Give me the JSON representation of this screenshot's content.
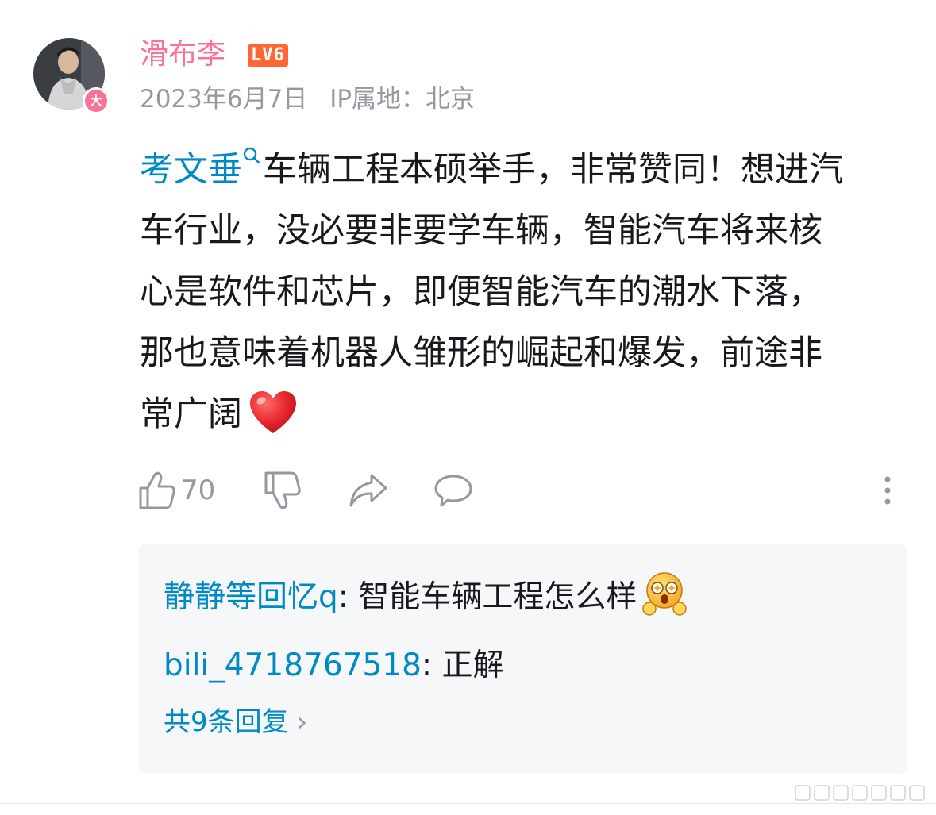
{
  "comment": {
    "username": "滑布李",
    "level": "LV6",
    "avatar_badge": "大",
    "date": "2023年6月7日",
    "ip_location": "IP属地：北京",
    "jump_keyword": "考文垂",
    "text_line_1": "车辆工程本硕举手，非常赞同！想进汽",
    "text_line_2": "车行业，没必要非要学车辆，智能汽车将来核",
    "text_line_3": "心是软件和芯片，即便智能汽车的潮水下落，",
    "text_line_4": "那也意味着机器人雏形的崛起和爆发，前途非",
    "text_line_5": "常广阔",
    "emoji": "heart-emoji"
  },
  "actions": {
    "like_count": "70",
    "like_icon": "thumbs-up-icon",
    "dislike_icon": "thumbs-down-icon",
    "share_icon": "share-icon",
    "reply_icon": "comment-icon",
    "more_icon": "more-vertical-icon"
  },
  "replies": [
    {
      "user": "静静等回忆q",
      "separator": ": ",
      "text": "智能车辆工程怎么样",
      "emoji": "starry-eyed-emoji"
    },
    {
      "user": "bili_4718767518",
      "separator": ": ",
      "text": "正解"
    }
  ],
  "reply_more": "共9条回复",
  "colors": {
    "username": "#fb7299",
    "link": "#008ac5",
    "meta": "#9499a0",
    "level_badge": "#ff6633",
    "reply_bg": "#f6f7f8"
  }
}
